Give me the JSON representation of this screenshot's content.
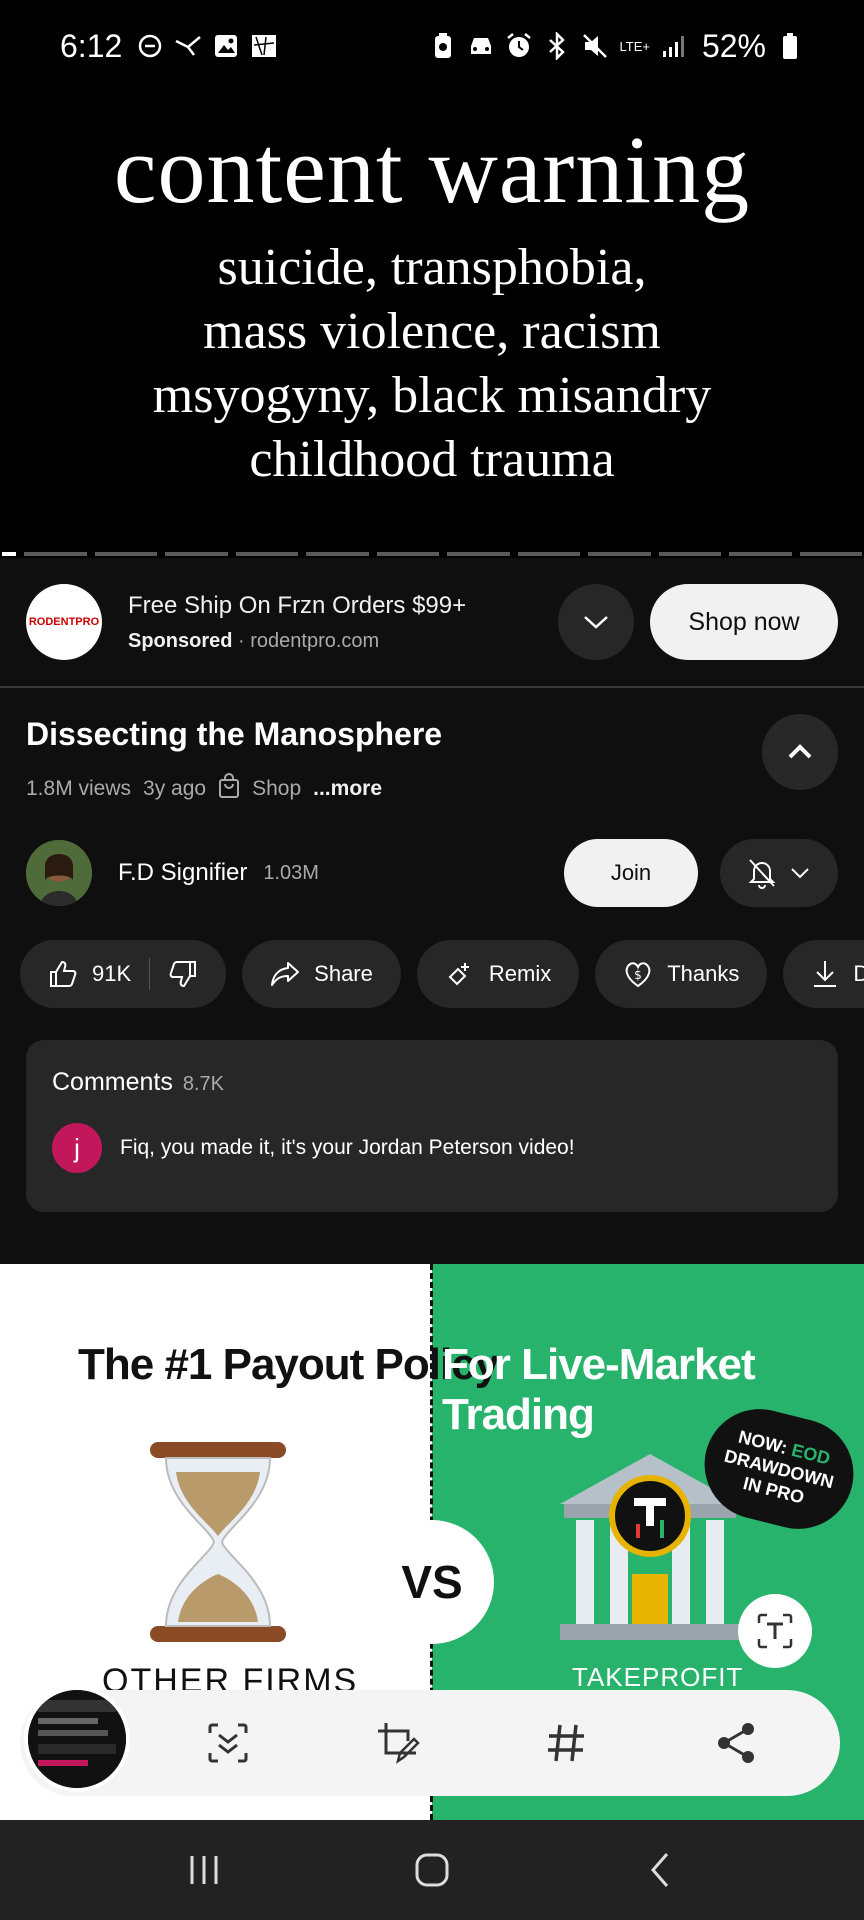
{
  "status_bar": {
    "time": "6:12",
    "left_icons": [
      "do-not-disturb-icon",
      "bird-icon",
      "gallery-icon",
      "map-icon"
    ],
    "right_icons": [
      "battery-saver-icon",
      "car-icon",
      "alarm-icon",
      "bluetooth-icon",
      "mute-icon",
      "lte-signal-icon",
      "signal-icon"
    ],
    "lte_label": "LTE+",
    "battery_percent": "52%"
  },
  "video": {
    "title": "content warning",
    "lines": [
      "suicide, transphobia,",
      "mass violence, racism",
      "msyogyny, black misandry",
      "childhood trauma"
    ]
  },
  "sponsored": {
    "title": "Free Ship On Frzn Orders $99+",
    "label": "Sponsored",
    "separator": "·",
    "domain": "rodentpro.com",
    "cta": "Shop now",
    "logo_text": "RODENTPRO"
  },
  "details": {
    "title": "Dissecting the Manosphere",
    "views": "1.8M views",
    "age": "3y ago",
    "shop": "Shop",
    "more": "...more"
  },
  "channel": {
    "name": "F.D Signifier",
    "subscribers": "1.03M",
    "join": "Join"
  },
  "actions": {
    "likes": "91K",
    "share": "Share",
    "remix": "Remix",
    "thanks": "Thanks",
    "download": "Do"
  },
  "comments": {
    "label": "Comments",
    "count": "8.7K",
    "avatar_initial": "j",
    "top_comment": "Fiq, you made it, it's your Jordan Peterson video!"
  },
  "ad_banner": {
    "left_title": "The #1 Payout Policy",
    "right_title": "For Live-Market Trading",
    "vs": "VS",
    "bubble_line1": "NOW:",
    "bubble_green": "EOD",
    "bubble_line2": "DRAWDOWN",
    "bubble_line3": "IN PRO",
    "left_caption": "OTHER FIRMS",
    "right_caption": "TAKEPROFIT",
    "accent_color": "#27b36c"
  },
  "toolbar": {
    "icons": [
      "smart-select-icon",
      "draw-crop-icon",
      "hashtag-icon",
      "share-icon"
    ]
  },
  "nav": {
    "icons": [
      "recent-apps-icon",
      "home-icon",
      "back-icon"
    ]
  }
}
